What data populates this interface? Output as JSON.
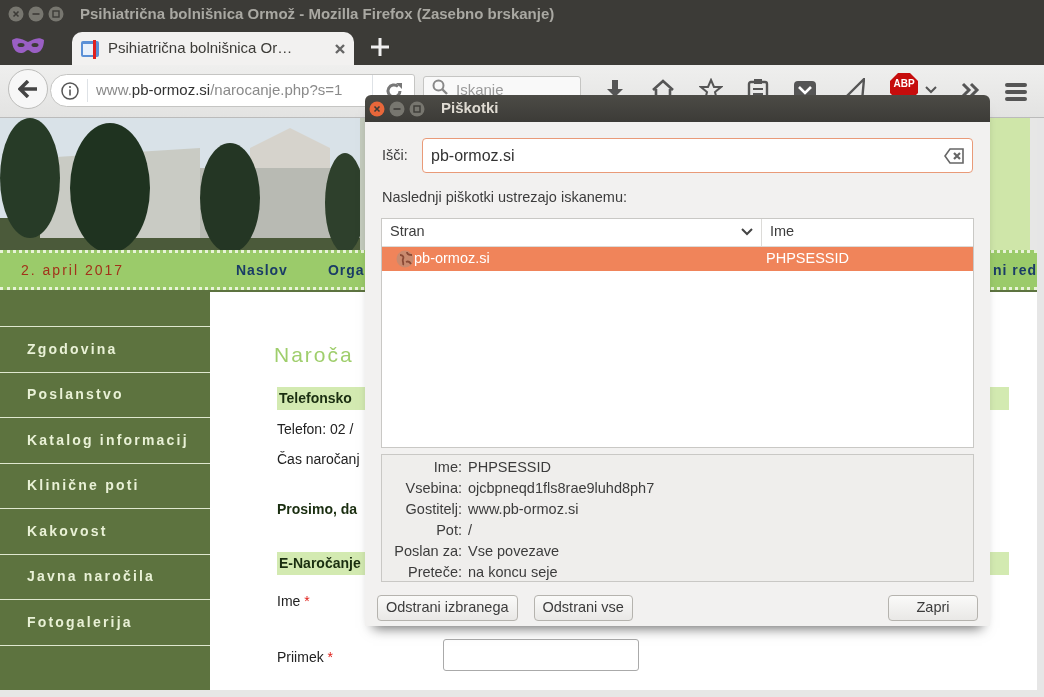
{
  "window": {
    "title": "Psihiatrična bolnišnica Ormož - Mozilla Firefox (Zasebno brskanje)"
  },
  "tabs": [
    {
      "title": "Psihiatrična bolnišnica Or…",
      "selected": true
    }
  ],
  "toolbar": {
    "url": "www.**pb-ormoz.si**/narocanje.php?s=1",
    "search": {
      "placeholder": "Iskanje"
    },
    "adblock_label": "ABP"
  },
  "site": {
    "date": "2. april 2017",
    "nav": [
      {
        "label": "Naslov",
        "kind": "left"
      },
      {
        "label": "Orga",
        "kind": "left"
      },
      {
        "label": "ni red",
        "kind": "right"
      }
    ],
    "sidebar": [
      "Zgodovina",
      "Poslanstvo",
      "Katalog informacij",
      "Klinične poti",
      "Kakovost",
      "Javna naročila",
      "Fotogalerija"
    ],
    "content": [
      {
        "kind": "heading",
        "text": "Naroča"
      },
      {
        "kind": "section",
        "text": "Telefonsko"
      },
      {
        "kind": "line",
        "text": "Telefon: 02 /"
      },
      {
        "kind": "line",
        "text": "Čas naročanj"
      },
      {
        "kind": "note",
        "text": "Prosimo, da"
      },
      {
        "kind": "section",
        "text": "E-Naročanje"
      },
      {
        "kind": "field",
        "label": "Ime",
        "mark": "*"
      },
      {
        "kind": "field",
        "label": "Priimek",
        "mark": "*",
        "input": true
      }
    ]
  },
  "dialog": {
    "title": "Piškotki",
    "search": {
      "label": "Išči:",
      "value": "pb-ormoz.si"
    },
    "caption": "Naslednji piškotki ustrezajo iskanemu:",
    "table": {
      "columns": [
        "Stran",
        "Ime"
      ],
      "rows": [
        {
          "site": "pb-ormoz.si",
          "name": "PHPSESSID",
          "selected": true
        }
      ]
    },
    "details": [
      {
        "label": "Ime:",
        "value": "PHPSESSID"
      },
      {
        "label": "Vsebina:",
        "value": "ojcbpneqd1fls8rae9luhd8ph7"
      },
      {
        "label": "Gostitelj:",
        "value": "www.pb-ormoz.si"
      },
      {
        "label": "Pot:",
        "value": "/"
      },
      {
        "label": "Poslan za:",
        "value": "Vse povezave"
      },
      {
        "label": "Preteče:",
        "value": "na koncu seje"
      }
    ],
    "buttons": [
      {
        "label": "Odstrani izbranega",
        "kind": "left"
      },
      {
        "label": "Odstrani vse",
        "kind": "left"
      },
      {
        "label": "Zapri",
        "kind": "right"
      }
    ]
  }
}
